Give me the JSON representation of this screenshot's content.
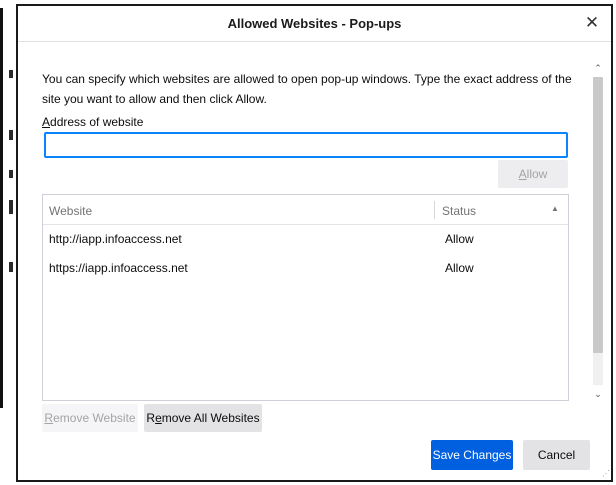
{
  "window": {
    "title": "Allowed Websites - Pop-ups",
    "close_glyph": "✕"
  },
  "intro_text": "You can specify which websites are allowed to open pop-up windows. Type the exact address of the site you want to allow and then click Allow.",
  "address": {
    "label_prefix": "",
    "label_access_key": "A",
    "label_rest": "ddress of website",
    "value": "",
    "placeholder": ""
  },
  "allow_button": {
    "access_key": "A",
    "rest": "llow"
  },
  "table": {
    "columns": [
      "Website",
      "Status"
    ],
    "sort_indicator": "▲",
    "rows": [
      {
        "website": "http://iapp.infoaccess.net",
        "status": "Allow"
      },
      {
        "website": "https://iapp.infoaccess.net",
        "status": "Allow"
      }
    ]
  },
  "remove_website": {
    "access_key": "R",
    "rest": "emove Website"
  },
  "remove_all": {
    "access_key": "e",
    "prefix": "R",
    "rest": "move All Websites"
  },
  "save_changes_label": "Save Changes",
  "cancel_label": "Cancel",
  "scrollbar": {
    "up_glyph": "⌃",
    "down_glyph": "⌄"
  },
  "colors": {
    "accent": "#0060df",
    "focus_ring": "#0a84ff"
  }
}
